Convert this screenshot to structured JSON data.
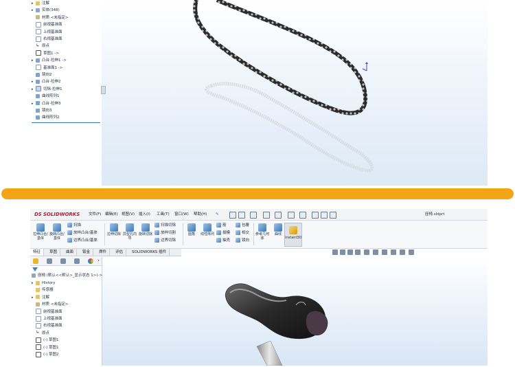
{
  "top_tree": {
    "items": [
      {
        "arrow": "▸",
        "icon": "annotation-icon",
        "label": "注解"
      },
      {
        "arrow": "▸",
        "icon": "solid-bodies-icon",
        "label": "实体(348)"
      },
      {
        "arrow": "",
        "icon": "material-icon",
        "label": "材质 <未指定>"
      },
      {
        "arrow": "",
        "icon": "plane-icon",
        "label": "前视基准面"
      },
      {
        "arrow": "",
        "icon": "plane-icon",
        "label": "上视基准面"
      },
      {
        "arrow": "",
        "icon": "plane-icon",
        "label": "右视基准面"
      },
      {
        "arrow": "",
        "icon": "origin-icon",
        "label": "原点"
      },
      {
        "arrow": "",
        "icon": "sketch-icon",
        "label": "草图1 ->"
      },
      {
        "arrow": "▸",
        "icon": "boss-extrude-icon",
        "label": "凸台-拉伸1 ->"
      },
      {
        "arrow": "",
        "icon": "plane-icon",
        "label": "基准面1 ->"
      },
      {
        "arrow": "",
        "icon": "mirror-icon",
        "label": "镜向2"
      },
      {
        "arrow": "▸",
        "icon": "boss-extrude-icon",
        "label": "凸台-拉伸2"
      },
      {
        "arrow": "▸",
        "icon": "cut-extrude-icon",
        "label": "切除-拉伸1"
      },
      {
        "arrow": "",
        "icon": "curve-pattern-icon",
        "label": "曲线阵列1"
      },
      {
        "arrow": "▸",
        "icon": "boss-extrude-icon",
        "label": "凸台-拉伸3"
      },
      {
        "arrow": "",
        "icon": "mirror-icon",
        "label": "镜向3"
      },
      {
        "arrow": "",
        "icon": "curve-pattern-icon",
        "label": "曲线阵列2"
      }
    ]
  },
  "app": {
    "logo_text": "SOLIDWORKS",
    "logo_mark": "DS",
    "filename": "座椅.sldprt",
    "menu": [
      "文件(F)",
      "编辑(E)",
      "视图(V)",
      "插入(I)",
      "工具(T)",
      "窗口(W)",
      "帮助(H)"
    ],
    "pin_icon": "pin-icon"
  },
  "ribbon": {
    "big": [
      {
        "label": "拉伸凸台/基体",
        "icon": "extruded-boss-icon"
      },
      {
        "label": "旋转凸台/基体",
        "icon": "revolved-boss-icon"
      }
    ],
    "group1": [
      "扫描",
      "放样凸台/基体",
      "边界凸台/基体"
    ],
    "big2": [
      {
        "label": "拉伸切除",
        "icon": "extruded-cut-icon"
      },
      {
        "label": "异型孔向导",
        "icon": "hole-wizard-icon"
      },
      {
        "label": "旋转切除",
        "icon": "revolved-cut-icon"
      }
    ],
    "group2": [
      "扫描切除",
      "放样切割",
      "边界切除"
    ],
    "big3": [
      {
        "label": "圆角",
        "icon": "fillet-icon"
      },
      {
        "label": "线性阵列",
        "icon": "linear-pattern-icon"
      }
    ],
    "group3": [
      "筋",
      "拔模",
      "抽壳"
    ],
    "group4": [
      "包覆",
      "相交",
      "镜向"
    ],
    "big4": [
      {
        "label": "参考几何体",
        "icon": "reference-geometry-icon"
      },
      {
        "label": "曲线",
        "icon": "curves-icon"
      }
    ],
    "instant3d": "Instant3D"
  },
  "tabs": [
    "特征",
    "草图",
    "曲面",
    "钣金",
    "焊件",
    "评估",
    "SOLIDWORKS 插件"
  ],
  "bottom_tree": {
    "root": "座椅 (默认<<默认>_显示状态 1>)->",
    "items": [
      {
        "arrow": "▸",
        "icon": "history-icon",
        "label": "History"
      },
      {
        "arrow": "",
        "icon": "sensor-icon",
        "label": "传感器"
      },
      {
        "arrow": "▸",
        "icon": "annotation-icon",
        "label": "注解"
      },
      {
        "arrow": "",
        "icon": "material-icon",
        "label": "材质 <未指定>"
      },
      {
        "arrow": "",
        "icon": "plane-icon",
        "label": "前视基准面"
      },
      {
        "arrow": "",
        "icon": "plane-icon",
        "label": "上视基准面"
      },
      {
        "arrow": "",
        "icon": "plane-icon",
        "label": "右视基准面"
      },
      {
        "arrow": "",
        "icon": "origin-icon",
        "label": "原点"
      },
      {
        "arrow": "",
        "icon": "sketch-icon",
        "label": "(-) 草图1"
      },
      {
        "arrow": "",
        "icon": "sketch-icon",
        "label": "(-) 草图1"
      },
      {
        "arrow": "",
        "icon": "sketch-icon",
        "label": "(-) 草图2"
      }
    ]
  },
  "colors": {
    "divider": "#f4a516",
    "selection": "#2f74c4",
    "logo": "#c8102e"
  }
}
